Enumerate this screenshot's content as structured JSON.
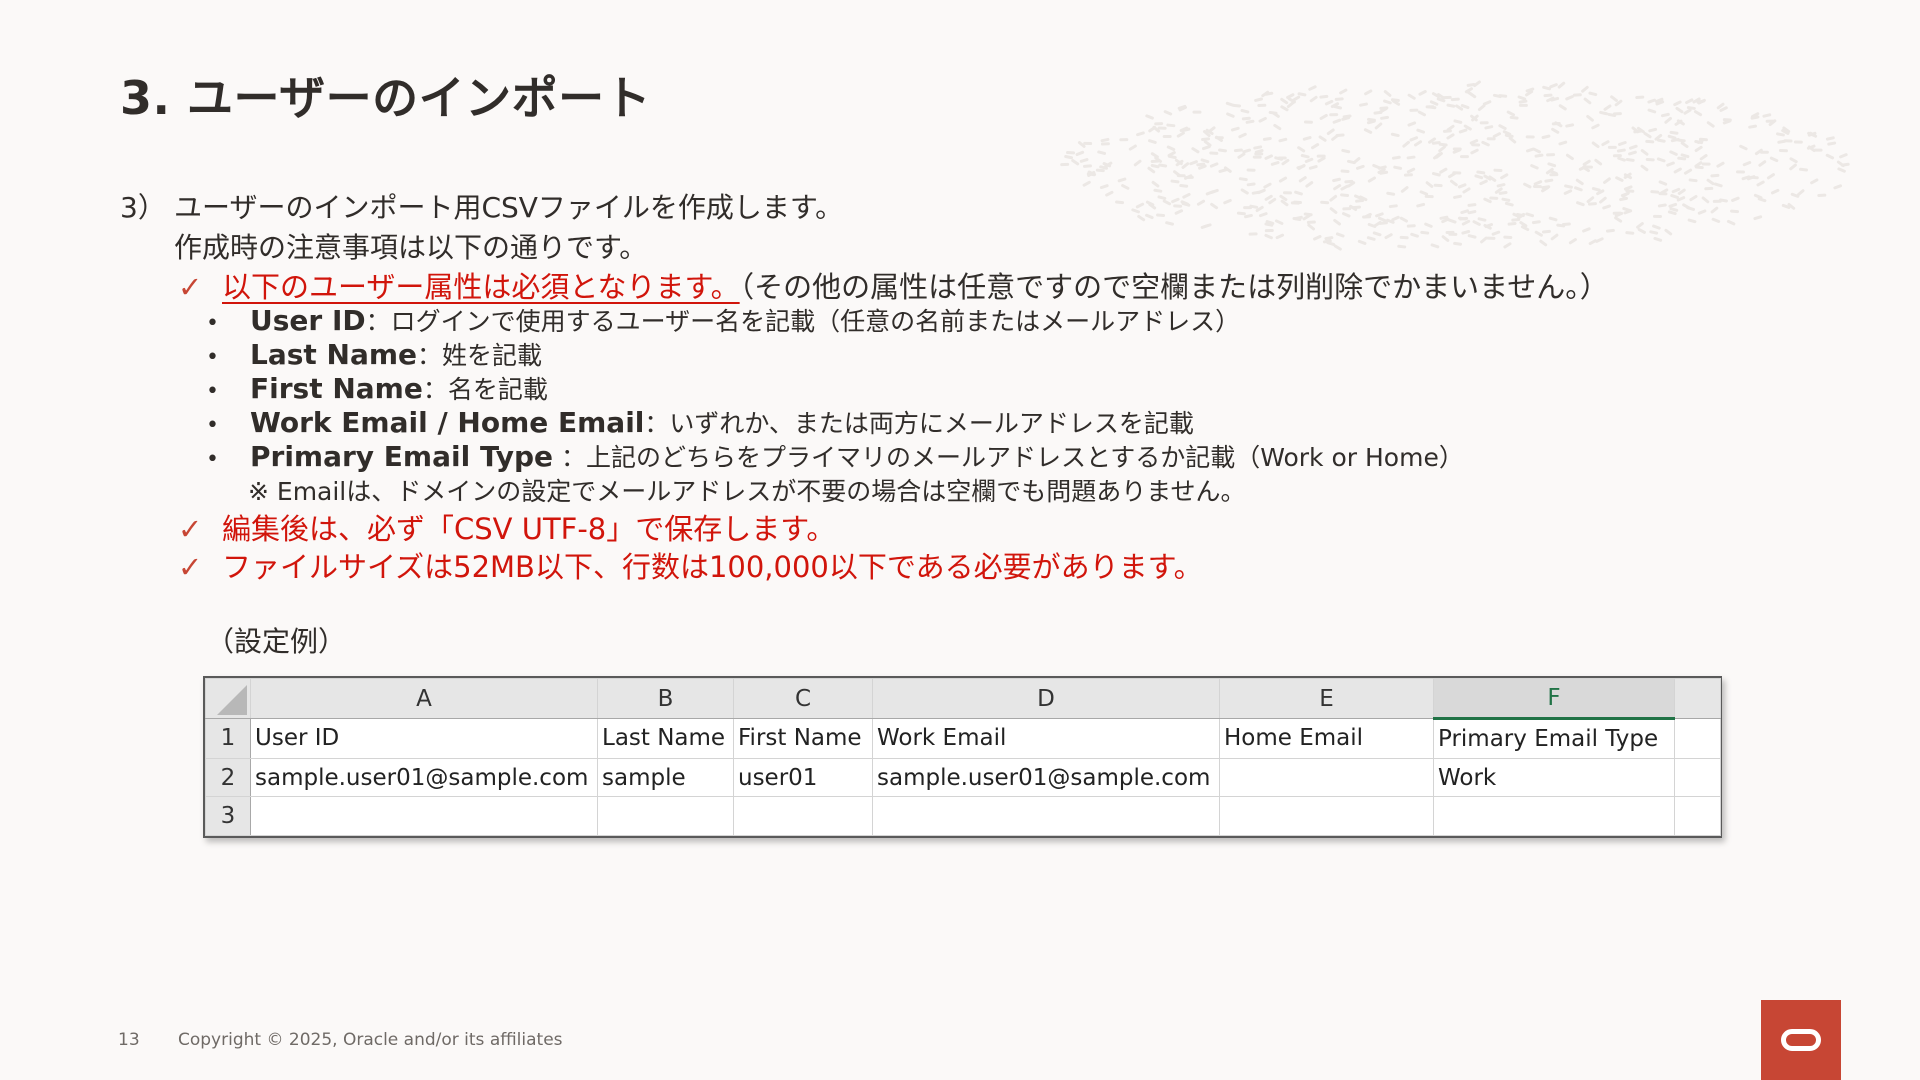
{
  "title": "3. ユーザーのインポート",
  "step": {
    "number": "3）",
    "line1": "ユーザーのインポート用CSVファイルを作成します。",
    "line2": "作成時の注意事項は以下の通りです。"
  },
  "checks": {
    "required_underlined": "以下のユーザー属性は必須となります。",
    "required_rest": "（その他の属性は任意ですので空欄または列削除でかまいません。）",
    "save": "編集後は、必ず「CSV UTF-8」で保存します。",
    "size": "ファイルサイズは52MB以下、行数は100,000以下である必要があります。"
  },
  "bullets": [
    {
      "key": "User ID",
      "sep": "：",
      "desc": "ログインで使用するユーザー名を記載（任意の名前またはメールアドレス）"
    },
    {
      "key": "Last Name",
      "sep": "：",
      "desc": "姓を記載"
    },
    {
      "key": "First Name",
      "sep": "：",
      "desc": "名を記載"
    },
    {
      "key": "Work Email / Home Email",
      "sep": "：",
      "desc": "いずれか、または両方にメールアドレスを記載"
    },
    {
      "key": "Primary Email Type",
      "sep": " ：",
      "desc": "上記のどちらをプライマリのメールアドレスとするか記載（Work or Home）"
    }
  ],
  "note": "※ Emailは、ドメインの設定でメールアドレスが不要の場合は空欄でも問題ありません。",
  "example_label": "（設定例）",
  "spreadsheet": {
    "columns": [
      "A",
      "B",
      "C",
      "D",
      "E",
      "F",
      ""
    ],
    "selected_column": "F",
    "row_numbers": [
      "1",
      "2",
      "3"
    ],
    "rows": [
      [
        "User ID",
        "Last Name",
        "First Name",
        "Work Email",
        "Home Email",
        "Primary Email Type",
        ""
      ],
      [
        "sample.user01@sample.com",
        "sample",
        "user01",
        "sample.user01@sample.com",
        "",
        "Work",
        ""
      ],
      [
        "",
        "",
        "",
        "",
        "",
        "",
        ""
      ]
    ]
  },
  "footer": {
    "page_number": "13",
    "copyright": "Copyright © 2025, Oracle and/or its affiliates"
  },
  "colors": {
    "accent_red": "#d1150b",
    "check_red": "#c74634",
    "logo_red": "#c74634",
    "selected_column_green": "#217346"
  },
  "icons": {
    "check": "check-mark-icon",
    "logo": "oracle-logo-icon"
  }
}
